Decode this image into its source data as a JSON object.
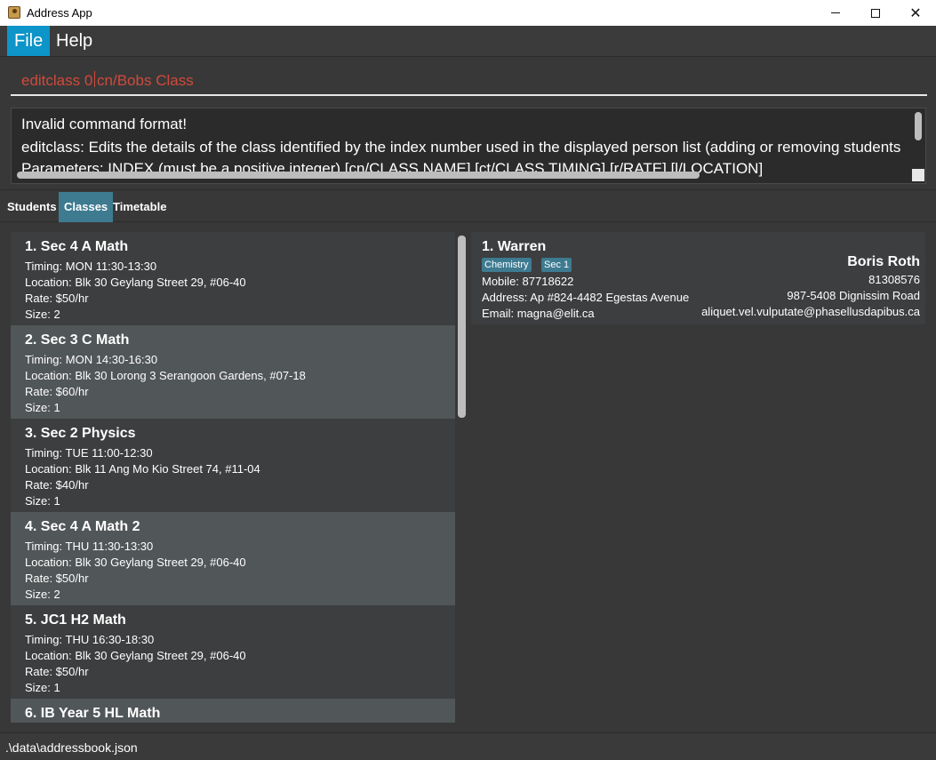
{
  "window": {
    "title": "Address App",
    "minimize_label": "",
    "maximize_label": "",
    "close_label": "✕"
  },
  "menu": {
    "file": "File",
    "help": "Help"
  },
  "command": {
    "value": "editclass 0 cn/Bobs Class"
  },
  "result": {
    "lines": [
      "Invalid command format!",
      "editclass: Edits the details of the class identified by the index number used in the displayed person list (adding or removing students",
      "Parameters: INDEX (must be a positive integer) [cn/CLASS NAME] [ct/CLASS TIMING] [r/RATE] [l/LOCATION]"
    ]
  },
  "tabs": [
    {
      "label": "Students",
      "selected": false
    },
    {
      "label": "Classes",
      "selected": true
    },
    {
      "label": "Timetable",
      "selected": false
    }
  ],
  "classes": [
    {
      "title": "1.  Sec 4 A Math",
      "timing": "Timing: MON 11:30-13:30",
      "location": "Location: Blk 30 Geylang Street 29, #06-40",
      "rate": "Rate: $50/hr",
      "size": "Size: 2"
    },
    {
      "title": "2.  Sec 3 C Math",
      "timing": "Timing: MON 14:30-16:30",
      "location": "Location: Blk 30 Lorong 3 Serangoon Gardens, #07-18",
      "rate": "Rate: $60/hr",
      "size": "Size: 1"
    },
    {
      "title": "3.  Sec 2 Physics",
      "timing": "Timing: TUE 11:00-12:30",
      "location": "Location: Blk 11 Ang Mo Kio Street 74, #11-04",
      "rate": "Rate: $40/hr",
      "size": "Size: 1"
    },
    {
      "title": "4.  Sec 4 A Math 2",
      "timing": "Timing: THU 11:30-13:30",
      "location": "Location: Blk 30 Geylang Street 29, #06-40",
      "rate": "Rate: $50/hr",
      "size": "Size: 2"
    },
    {
      "title": "5.  JC1 H2 Math",
      "timing": "Timing: THU 16:30-18:30",
      "location": "Location: Blk 30 Geylang Street 29, #06-40",
      "rate": "Rate: $50/hr",
      "size": "Size: 1"
    },
    {
      "title": "6.  IB Year 5 HL Math",
      "timing": "",
      "location": "",
      "rate": "",
      "size": ""
    }
  ],
  "student": {
    "title": "1.  Warren",
    "tags": [
      "Chemistry",
      "Sec 1"
    ],
    "mobile": "Mobile: 87718622",
    "address": "Address: Ap #824-4482 Egestas Avenue",
    "email": "Email: magna@elit.ca",
    "parent": {
      "name": "Boris Roth",
      "phone": "81308576",
      "address": "987-5408 Dignissim Road",
      "email": "aliquet.vel.vulputate@phasellusdapibus.ca"
    }
  },
  "status": {
    "path": ".\\data\\addressbook.json"
  },
  "colors": {
    "accent_blue": "#0d94c8",
    "tab_selected": "#3e7b91",
    "tag_bg": "#3e7b91",
    "command_text": "#d04a3c",
    "background": "#383838"
  }
}
